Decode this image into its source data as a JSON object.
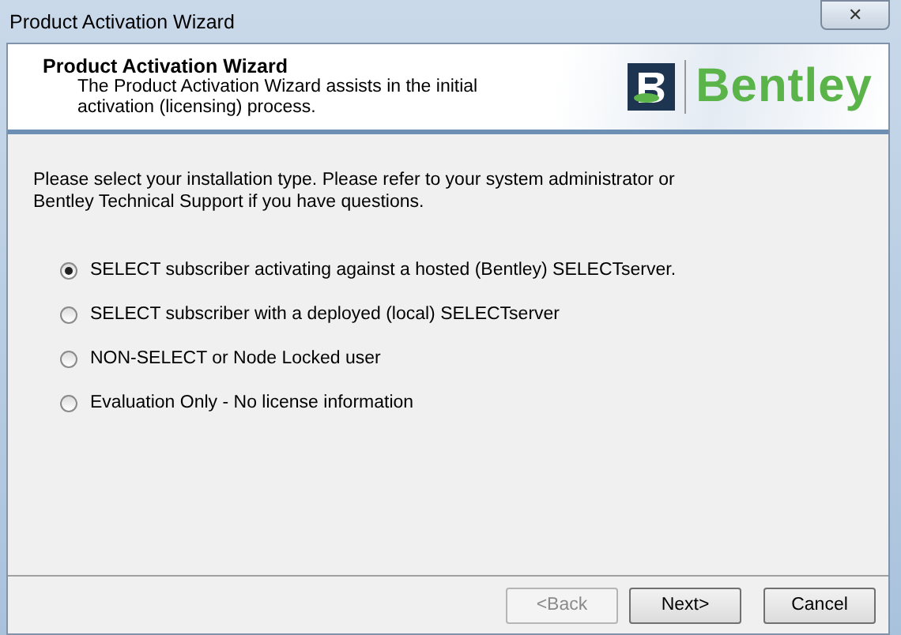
{
  "window": {
    "title": "Product Activation Wizard",
    "close": "✕"
  },
  "header": {
    "title": "Product Activation Wizard",
    "subtitle": "The Product Activation Wizard assists in the initial activation (licensing) process.",
    "logo_text": "Bentley"
  },
  "instructions": "Please select your installation type. Please refer to your system administrator or Bentley Technical Support if you have questions.",
  "options": [
    {
      "label": "SELECT subscriber activating against a hosted (Bentley) SELECTserver.",
      "selected": true
    },
    {
      "label": "SELECT subscriber with a deployed (local) SELECTserver",
      "selected": false
    },
    {
      "label": "NON-SELECT or Node Locked user",
      "selected": false
    },
    {
      "label": "Evaluation Only - No license information",
      "selected": false
    }
  ],
  "buttons": [
    {
      "label": "<Back",
      "disabled": true
    },
    {
      "label": "Next>",
      "disabled": false
    },
    {
      "label": "Cancel",
      "disabled": false
    }
  ]
}
